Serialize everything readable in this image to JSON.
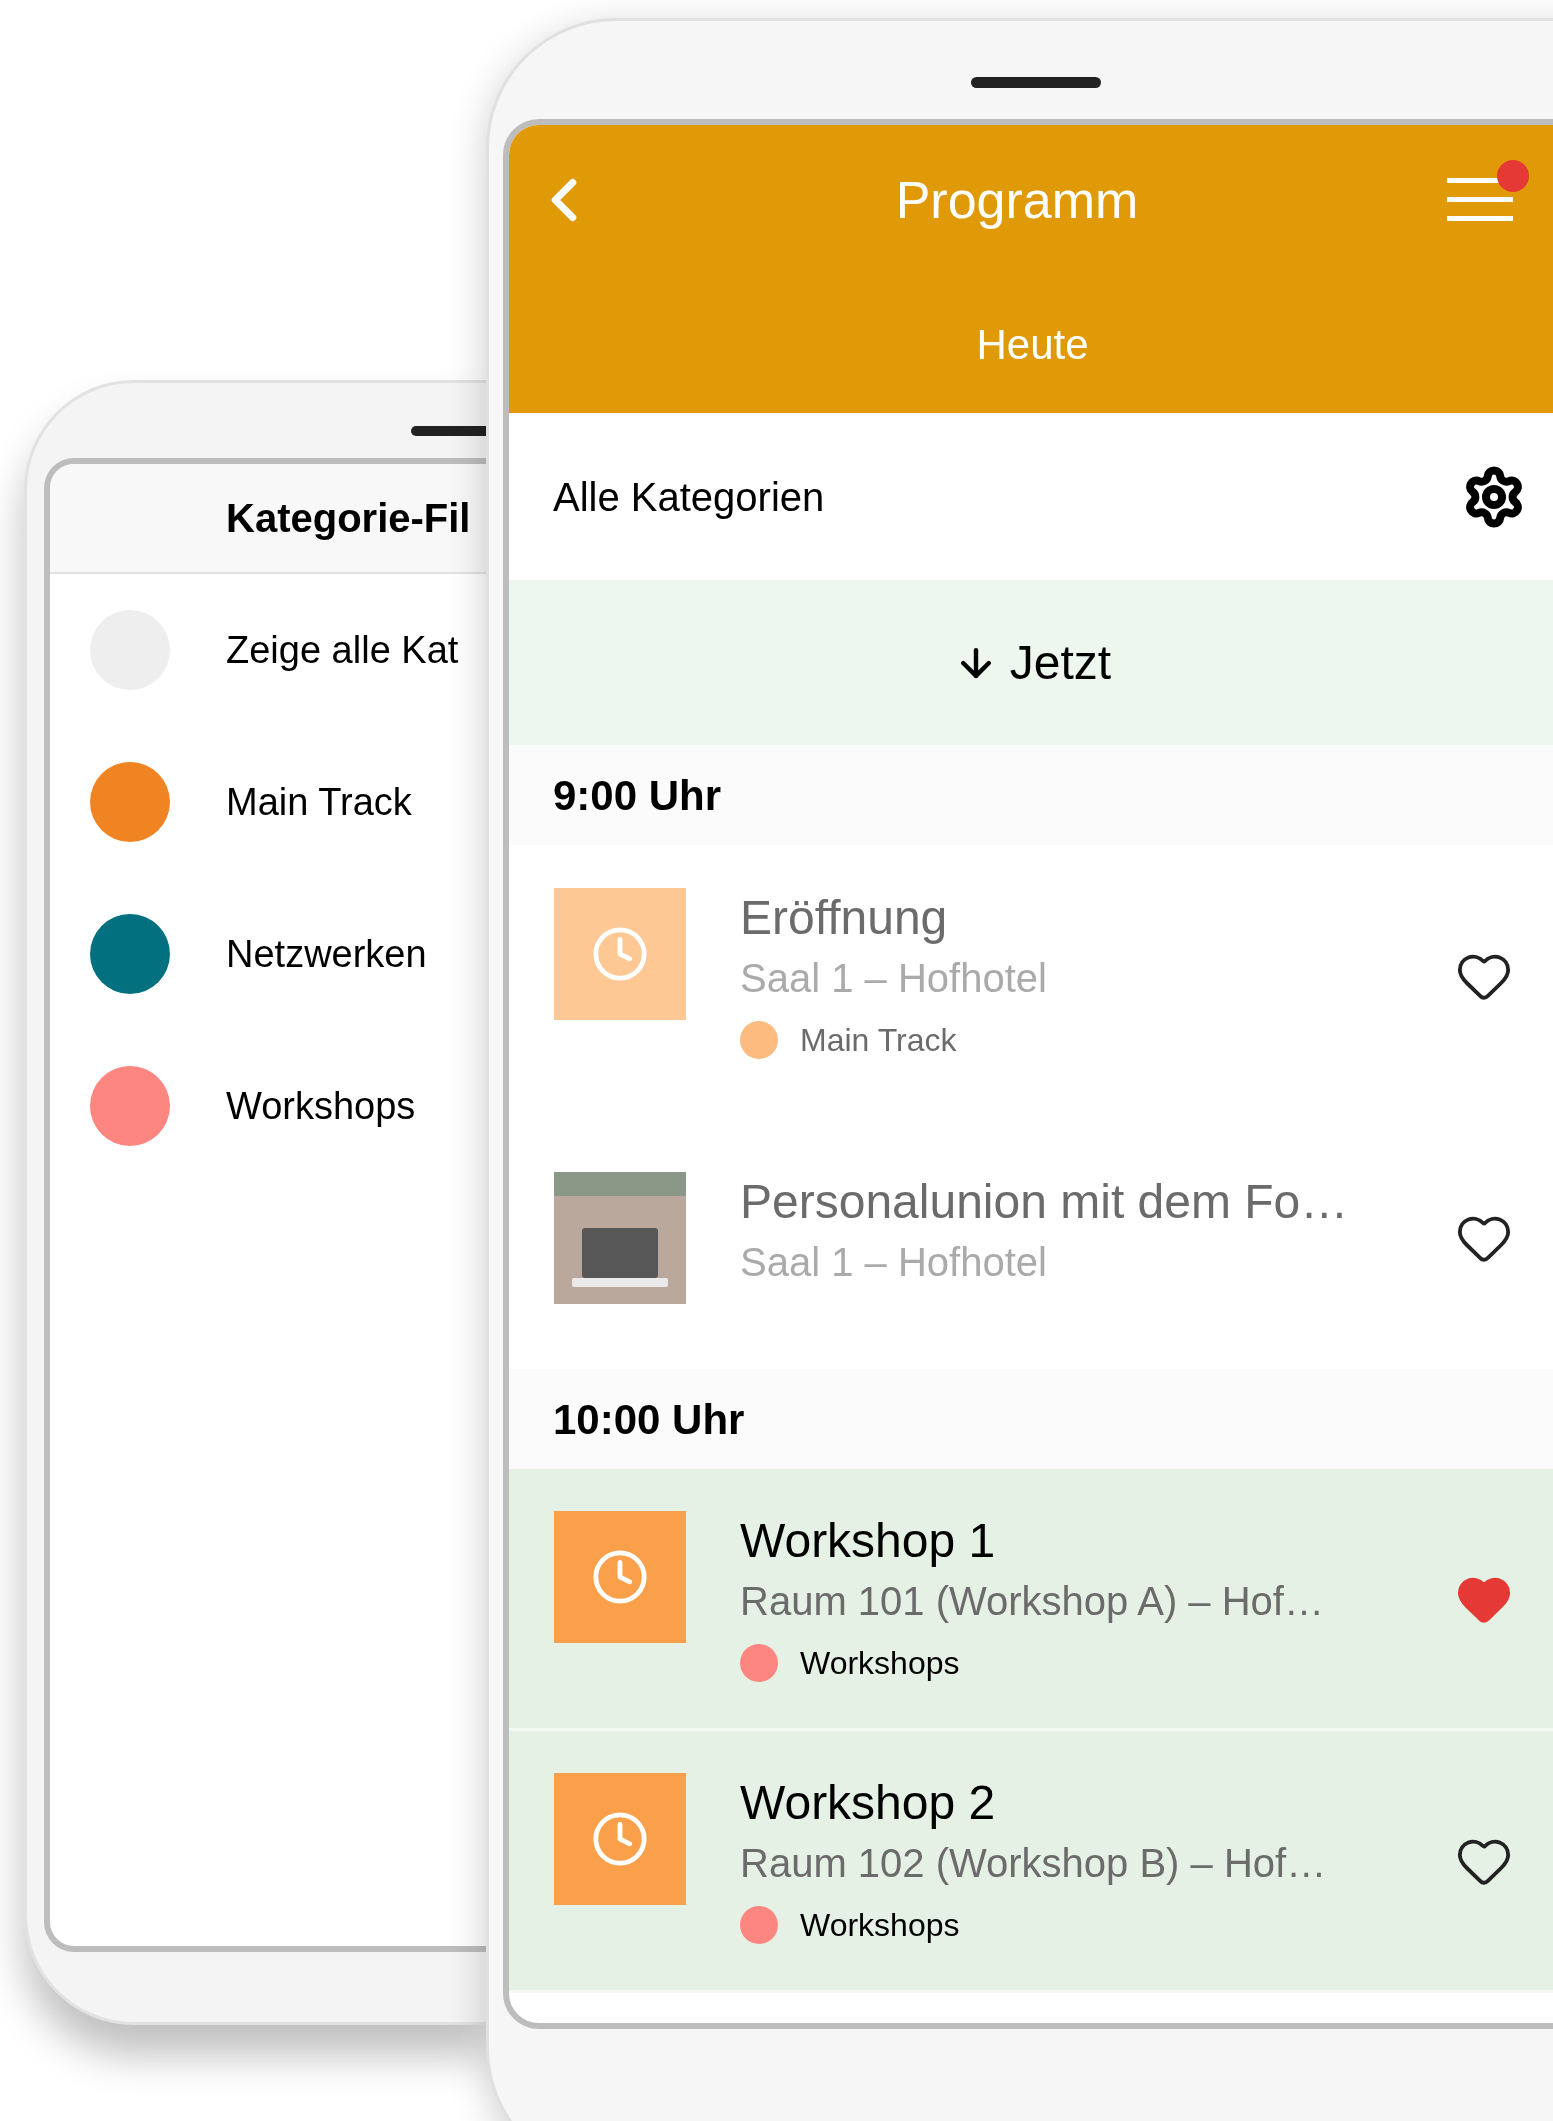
{
  "filter_screen": {
    "title": "Kategorie-Fil",
    "categories": [
      {
        "label": "Zeige alle Kat",
        "color": "#eeeeee"
      },
      {
        "label": "Main Track",
        "color": "#f08322"
      },
      {
        "label": "Netzwerken",
        "color": "#037080"
      },
      {
        "label": "Workshops",
        "color": "#fd8780"
      }
    ]
  },
  "program_screen": {
    "header": {
      "title": "Programm",
      "notification": true,
      "day": "Heute"
    },
    "filter": {
      "label": "Alle Kategorien"
    },
    "now_button": {
      "label": "Jetzt"
    },
    "sections": [
      {
        "time": "9:00 Uhr",
        "sessions": [
          {
            "title": "Eröffnung",
            "room": "Saal 1 – Hofhotel",
            "kind": "clock",
            "past": true,
            "current": false,
            "favorite": false,
            "category": {
              "label": "Main Track",
              "color": "#fdbb80"
            }
          },
          {
            "title": "Personalunion mit dem Fo…",
            "room": "Saal 1 – Hofhotel",
            "kind": "photo",
            "past": true,
            "current": false,
            "favorite": false
          }
        ]
      },
      {
        "time": "10:00 Uhr",
        "sessions": [
          {
            "title": "Workshop 1",
            "room": "Raum 101 (Workshop A) – Hof…",
            "kind": "clock",
            "past": false,
            "current": true,
            "favorite": true,
            "category": {
              "label": "Workshops",
              "color": "#fd8780"
            }
          },
          {
            "title": "Workshop 2",
            "room": "Raum 102 (Workshop B) – Hof…",
            "kind": "clock",
            "past": false,
            "current": true,
            "favorite": false,
            "category": {
              "label": "Workshops",
              "color": "#fd8780"
            }
          }
        ]
      }
    ]
  }
}
